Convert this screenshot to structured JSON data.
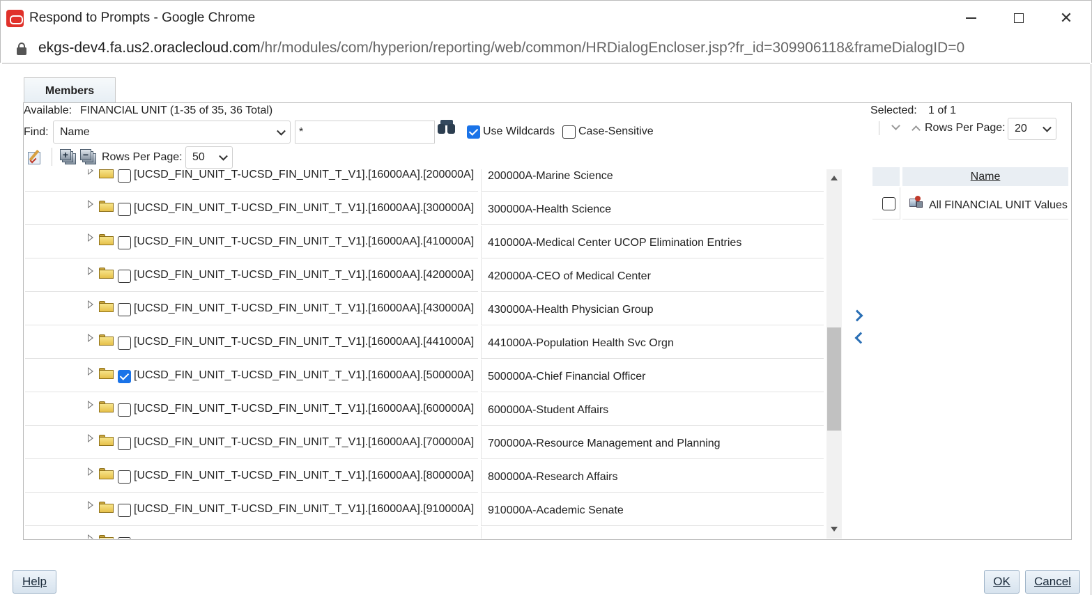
{
  "window": {
    "title": "Respond to Prompts - Google Chrome",
    "url_host": "ekgs-dev4.fa.us2.oraclecloud.com",
    "url_path": "/hr/modules/com/hyperion/reporting/web/common/HRDialogEncloser.jsp?fr_id=309906118&frameDialogID=0"
  },
  "tab": {
    "label": "Members"
  },
  "available": {
    "label": "Available:",
    "value": "FINANCIAL UNIT (1-35 of 35, 36 Total)",
    "find_label": "Find:",
    "find_field": "Name",
    "search_value": "*",
    "use_wildcards": "Use Wildcards",
    "case_sensitive": "Case-Sensitive",
    "rows_per_page_label": "Rows Per Page:",
    "rows_per_page": "50"
  },
  "rows": [
    {
      "key": "[UCSD_FIN_UNIT_T-UCSD_FIN_UNIT_T_V1].[16000AA].[200000A]",
      "desc": "200000A-Marine Science",
      "checked": false
    },
    {
      "key": "[UCSD_FIN_UNIT_T-UCSD_FIN_UNIT_T_V1].[16000AA].[300000A]",
      "desc": "300000A-Health Science",
      "checked": false
    },
    {
      "key": "[UCSD_FIN_UNIT_T-UCSD_FIN_UNIT_T_V1].[16000AA].[410000A]",
      "desc": "410000A-Medical Center UCOP Elimination Entries",
      "checked": false
    },
    {
      "key": "[UCSD_FIN_UNIT_T-UCSD_FIN_UNIT_T_V1].[16000AA].[420000A]",
      "desc": "420000A-CEO of Medical Center",
      "checked": false
    },
    {
      "key": "[UCSD_FIN_UNIT_T-UCSD_FIN_UNIT_T_V1].[16000AA].[430000A]",
      "desc": "430000A-Health Physician Group",
      "checked": false
    },
    {
      "key": "[UCSD_FIN_UNIT_T-UCSD_FIN_UNIT_T_V1].[16000AA].[441000A]",
      "desc": "441000A-Population Health Svc Orgn",
      "checked": false
    },
    {
      "key": "[UCSD_FIN_UNIT_T-UCSD_FIN_UNIT_T_V1].[16000AA].[500000A]",
      "desc": "500000A-Chief Financial Officer",
      "checked": true
    },
    {
      "key": "[UCSD_FIN_UNIT_T-UCSD_FIN_UNIT_T_V1].[16000AA].[600000A]",
      "desc": "600000A-Student Affairs",
      "checked": false
    },
    {
      "key": "[UCSD_FIN_UNIT_T-UCSD_FIN_UNIT_T_V1].[16000AA].[700000A]",
      "desc": "700000A-Resource Management and Planning",
      "checked": false
    },
    {
      "key": "[UCSD_FIN_UNIT_T-UCSD_FIN_UNIT_T_V1].[16000AA].[800000A]",
      "desc": "800000A-Research Affairs",
      "checked": false
    },
    {
      "key": "[UCSD_FIN_UNIT_T-UCSD_FIN_UNIT_T_V1].[16000AA].[910000A]",
      "desc": "910000A-Academic Senate",
      "checked": false
    },
    {
      "key": "",
      "desc": "",
      "checked": false
    }
  ],
  "selected": {
    "label": "Selected:",
    "count": "1 of 1",
    "rows_per_page_label": "Rows Per Page:",
    "rows_per_page": "20",
    "column_header": "Name",
    "items": [
      {
        "label": "All FINANCIAL UNIT Values"
      }
    ]
  },
  "buttons": {
    "help": "Help",
    "ok": "OK",
    "cancel": "Cancel"
  },
  "colors": {
    "checkbox_checked": "#1a73e8",
    "move_arrows": "#2a6fb5",
    "logo": "#e0312a"
  }
}
